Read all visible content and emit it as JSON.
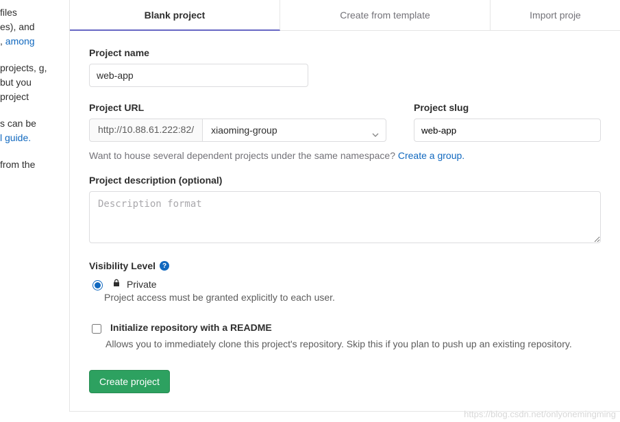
{
  "sidebar": {
    "p1_a": " files ",
    "p1_b": "es), and ",
    "p1_link": "among",
    "p2": "projects, g, but you project",
    "p3_a": "s can be ",
    "p3_link": "l guide.",
    "p4": " from the"
  },
  "tabs": {
    "blank": "Blank project",
    "template": "Create from template",
    "import": "Import proje"
  },
  "projectName": {
    "label": "Project name",
    "value": "web-app"
  },
  "projectUrl": {
    "label": "Project URL",
    "prefix": "http://10.88.61.222:82/",
    "namespace": "xiaoming-group"
  },
  "projectSlug": {
    "label": "Project slug",
    "value": "web-app"
  },
  "namespaceHint": {
    "text": "Want to house several dependent projects under the same namespace? ",
    "link": "Create a group."
  },
  "description": {
    "label": "Project description (optional)",
    "placeholder": "Description format"
  },
  "visibility": {
    "label": "Visibility Level",
    "private": "Private",
    "private_sub": "Project access must be granted explicitly to each user."
  },
  "readme": {
    "title": "Initialize repository with a README",
    "sub": "Allows you to immediately clone this project's repository. Skip this if you plan to push up an existing repository."
  },
  "submit": "Create project",
  "watermark": "https://blog.csdn.net/onlyonemingming"
}
